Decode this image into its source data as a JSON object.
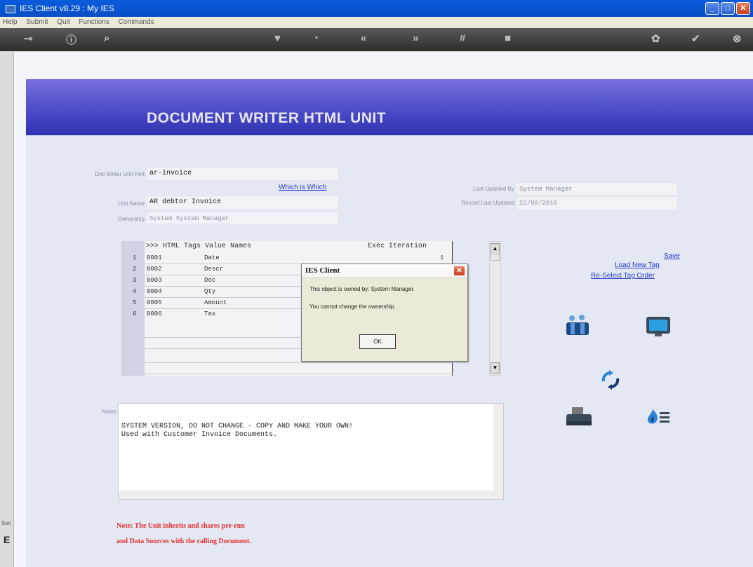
{
  "window": {
    "title": "IES Client v8.29 : My IES",
    "menus": [
      "Help",
      "Submit",
      "Quit",
      "Functions",
      "Commands"
    ]
  },
  "toolbar": {
    "icons": [
      "key-icon",
      "info-icon",
      "search-icon",
      "heart-icon",
      "clock-icon",
      "rewind-icon",
      "forward-icon",
      "hash-icon",
      "stop-icon",
      "gear-icon",
      "check-icon",
      "close-icon"
    ],
    "glyphs": [
      "⊸",
      "ⓘ",
      "⌕",
      "♥",
      "◔",
      "«",
      "»",
      "#",
      "■",
      "✿",
      "✔",
      "⊗"
    ]
  },
  "header": {
    "title": "DOCUMENT WRITER HTML UNIT"
  },
  "form": {
    "doc_writer_label": "Doc Writer Unit Hint",
    "doc_writer_value": "ar-invoice",
    "which_link": "Which is Which",
    "unit_name_label": "Unit Name",
    "unit_name_value": "AR debtor Invoice",
    "ownership_label": "Ownership",
    "ownership_value": "System  System Manager",
    "last_updated_by_label": "Last Updated By",
    "last_updated_by_value": "System Manager",
    "record_last_updated_label": "Record Last Updated",
    "record_last_updated_value": "22/08/2018"
  },
  "actions": {
    "save": "Save",
    "load_new_tag": "Load New Tag",
    "reselect": "Re-Select Tag Order"
  },
  "table": {
    "headers": [
      ">>> HTML Tags",
      "Value Names",
      "Exec Iteration"
    ],
    "rows": [
      {
        "num": "1",
        "tag": "0001",
        "name": "Date",
        "iter": "1"
      },
      {
        "num": "2",
        "tag": "0002",
        "name": "Descr",
        "iter": ""
      },
      {
        "num": "3",
        "tag": "0003",
        "name": "Doc",
        "iter": ""
      },
      {
        "num": "4",
        "tag": "0004",
        "name": "Qty",
        "iter": ""
      },
      {
        "num": "5",
        "tag": "0005",
        "name": "Amount",
        "iter": ""
      },
      {
        "num": "6",
        "tag": "0006",
        "name": "Tax",
        "iter": ""
      }
    ]
  },
  "notes": {
    "label": "Notes",
    "text": "SYSTEM VERSION, DO NOT CHANGE - COPY AND MAKE YOUR OWN!\nUsed with Customer Invoice Documents."
  },
  "footer": {
    "line1": "Note: The Unit inherits and shares pre-run",
    "line2": "and Data Sources with the calling Document."
  },
  "dialog": {
    "title": "IES Client",
    "message1": "This object is owned by: System Manager.",
    "message2": "You cannot change the ownership.",
    "ok": "OK"
  },
  "leftstrip": {
    "s1": "Sec",
    "s2": "E"
  }
}
